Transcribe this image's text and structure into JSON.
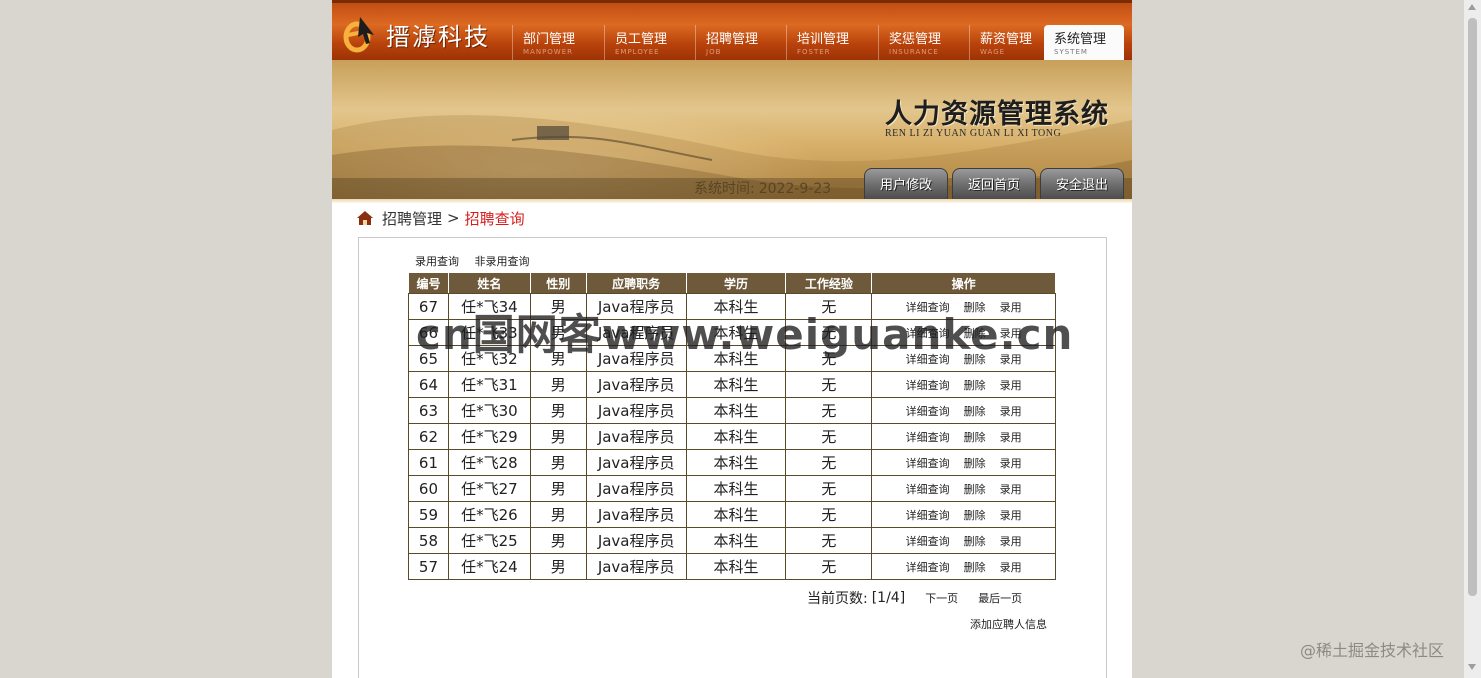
{
  "header": {
    "company": "搢滹科技",
    "nav": [
      {
        "cn": "部门管理",
        "en": "MANPOWER",
        "active": false
      },
      {
        "cn": "员工管理",
        "en": "EMPLOYEE",
        "active": false
      },
      {
        "cn": "招聘管理",
        "en": "JOB",
        "active": false
      },
      {
        "cn": "培训管理",
        "en": "FOSTER",
        "active": false
      },
      {
        "cn": "奖惩管理",
        "en": "INSURANCE",
        "active": false
      },
      {
        "cn": "薪资管理",
        "en": "WAGE",
        "active": false
      },
      {
        "cn": "系统管理",
        "en": "SYSTEM",
        "active": true
      }
    ]
  },
  "banner": {
    "title_cn": "人力资源管理系统",
    "title_en": "REN LI ZI YUAN GUAN LI XI TONG",
    "time_label": "系统时间:",
    "time_value": "2022-9-23",
    "buttons": [
      "用户修改",
      "返回首页",
      "安全退出"
    ]
  },
  "breadcrumb": {
    "parent": "招聘管理",
    "separator": ">",
    "current": "招聘查询"
  },
  "subnav": [
    "录用查询",
    "非录用查询"
  ],
  "table": {
    "columns": [
      "编号",
      "姓名",
      "性别",
      "应聘职务",
      "学历",
      "工作经验",
      "操作"
    ],
    "actions": [
      "详细查询",
      "删除",
      "录用"
    ],
    "rows": [
      {
        "id": "67",
        "name": "任*飞34",
        "gender": "男",
        "job": "Java程序员",
        "edu": "本科生",
        "exp": "无"
      },
      {
        "id": "66",
        "name": "任*飞33",
        "gender": "男",
        "job": "Java程序员",
        "edu": "本科生",
        "exp": "无"
      },
      {
        "id": "65",
        "name": "任*飞32",
        "gender": "男",
        "job": "Java程序员",
        "edu": "本科生",
        "exp": "无"
      },
      {
        "id": "64",
        "name": "任*飞31",
        "gender": "男",
        "job": "Java程序员",
        "edu": "本科生",
        "exp": "无"
      },
      {
        "id": "63",
        "name": "任*飞30",
        "gender": "男",
        "job": "Java程序员",
        "edu": "本科生",
        "exp": "无"
      },
      {
        "id": "62",
        "name": "任*飞29",
        "gender": "男",
        "job": "Java程序员",
        "edu": "本科生",
        "exp": "无"
      },
      {
        "id": "61",
        "name": "任*飞28",
        "gender": "男",
        "job": "Java程序员",
        "edu": "本科生",
        "exp": "无"
      },
      {
        "id": "60",
        "name": "任*飞27",
        "gender": "男",
        "job": "Java程序员",
        "edu": "本科生",
        "exp": "无"
      },
      {
        "id": "59",
        "name": "任*飞26",
        "gender": "男",
        "job": "Java程序员",
        "edu": "本科生",
        "exp": "无"
      },
      {
        "id": "58",
        "name": "任*飞25",
        "gender": "男",
        "job": "Java程序员",
        "edu": "本科生",
        "exp": "无"
      },
      {
        "id": "57",
        "name": "任*飞24",
        "gender": "男",
        "job": "Java程序员",
        "edu": "本科生",
        "exp": "无"
      }
    ]
  },
  "pager": {
    "label": "当前页数:",
    "indicator": "[1/4]",
    "next": "下一页",
    "last": "最后一页"
  },
  "add_link": "添加应聘人信息",
  "overlays": {
    "watermark": "cn国网客www.weiguanke.cn",
    "community": "@稀土掘金技术社区"
  },
  "colors": {
    "nav_orange": "#c24d12",
    "header_brown": "#6e5a3a",
    "breadcrumb_active": "#d71e1e"
  }
}
